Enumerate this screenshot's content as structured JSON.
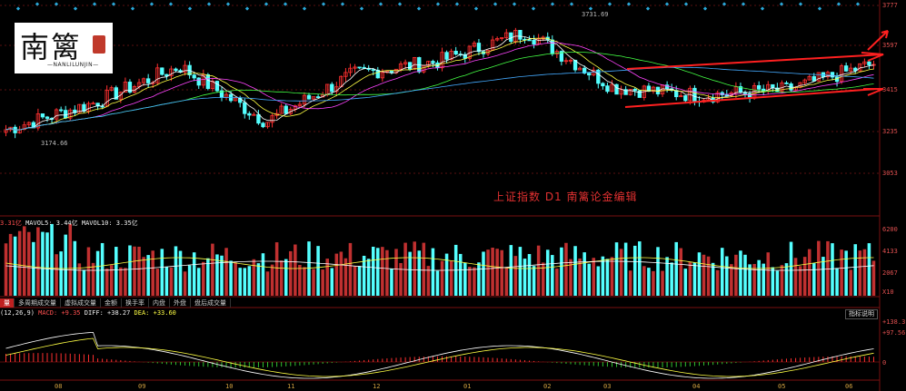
{
  "header": {
    "indicator_row_label": "上证指数"
  },
  "price_axis": [
    "3777",
    "3597",
    "3415",
    "3235",
    "3053"
  ],
  "price_annotations": {
    "high": "3731.69",
    "low": "3174.66"
  },
  "watermark": "上证指数  D1  南篱论金编辑",
  "logo": {
    "char": "南篱",
    "sub": "—NANLILUNJIN—"
  },
  "volume": {
    "legend": {
      "vol": "3.31亿",
      "mavol5_label": "MAVOL5: 3.44亿",
      "mavol10_label": "MAVOL10: 3.35亿"
    },
    "axis": [
      "6200",
      "4133",
      "2067",
      "X10"
    ]
  },
  "tabs": [
    "量",
    "多周期成交量",
    "虚拟成交量",
    "金额",
    "换手率",
    "内盘",
    "外盘",
    "盘后成交量"
  ],
  "macd": {
    "legend": {
      "params": "(12,26,9)",
      "macd": "MACD: +9.35",
      "diff": "DIFF: +38.27",
      "dea": "DEA: +33.60"
    },
    "axis": [
      "+138.3",
      "+97.56",
      "0"
    ],
    "help_label": "指标说明"
  },
  "x_axis": [
    "08",
    "09",
    "10",
    "11",
    "12",
    "01",
    "02",
    "03",
    "04",
    "05",
    "06"
  ],
  "colors": {
    "up": "#ff3030",
    "down": "#54ffff",
    "ma5": "#ffffff",
    "ma10": "#ffff44",
    "ma20": "#ff44ff",
    "ma60": "#44ff44",
    "ma120": "#44aaff",
    "trend": "#ff2020"
  },
  "chart_data": {
    "type": "line",
    "title": "上证指数  D1",
    "ylim": [
      3000,
      3790
    ],
    "x": [
      "08",
      "09",
      "10",
      "11",
      "12",
      "01",
      "02",
      "03",
      "04",
      "05",
      "06"
    ],
    "series": [
      {
        "name": "上证指数",
        "values": [
          3320,
          3420,
          3560,
          3350,
          3530,
          3580,
          3690,
          3480,
          3450,
          3470,
          3570
        ]
      }
    ],
    "annotations": [
      "3731.69",
      "3174.66"
    ]
  }
}
